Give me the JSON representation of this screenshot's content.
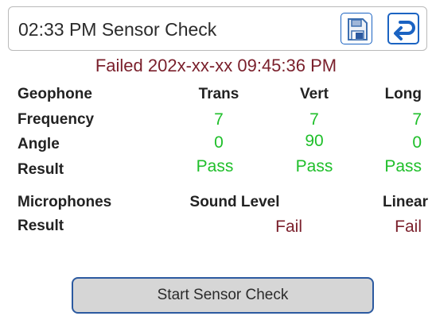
{
  "header": {
    "title": "02:33 PM Sensor Check",
    "save_icon": "save-icon",
    "back_icon": "back-arrow-icon",
    "accent_color": "#1b63c2"
  },
  "status": {
    "text": "Failed 202x-xx-xx 09:45:36 PM",
    "color": "#7a1f2b"
  },
  "geophone": {
    "label": "Geophone",
    "columns": [
      "Trans",
      "Vert",
      "Long"
    ],
    "frequency": {
      "label": "Frequency",
      "values": [
        "7",
        "7",
        "7"
      ]
    },
    "angle": {
      "label": "Angle",
      "values": [
        "0",
        "90",
        "0"
      ]
    },
    "result": {
      "label": "Result",
      "values": [
        "Pass",
        "Pass",
        "Pass"
      ]
    }
  },
  "microphones": {
    "label": "Microphones",
    "columns": [
      "Sound Level",
      "Linear"
    ],
    "result": {
      "label": "Result",
      "values": [
        "Fail",
        "Fail"
      ]
    }
  },
  "colors": {
    "pass": "#1fbf2a",
    "fail": "#7a1f2b"
  },
  "start_button": {
    "label": "Start Sensor Check"
  }
}
